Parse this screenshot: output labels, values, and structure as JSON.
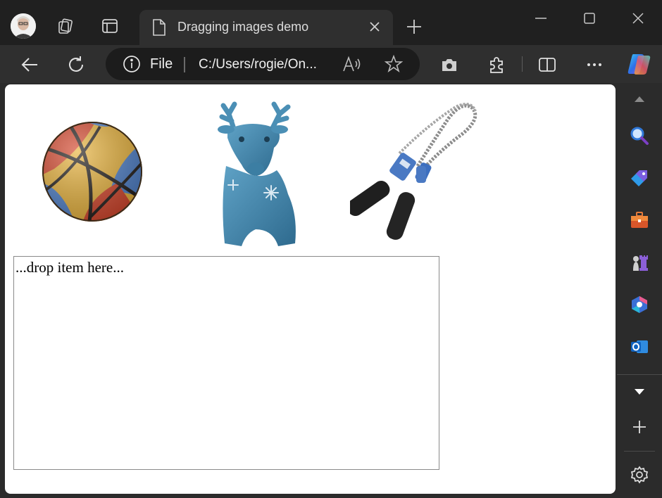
{
  "browser": {
    "tab": {
      "title": "Dragging images demo"
    },
    "address": {
      "scheme_label": "File",
      "url": "C:/Users/rogie/On..."
    },
    "colors": {
      "frame": "#202020",
      "toolbar": "#2f2f2f",
      "address_bg": "#1c1c1c",
      "content_bg": "#ffffff"
    }
  },
  "page": {
    "images": [
      {
        "name": "basketball",
        "icon": "basketball-image"
      },
      {
        "name": "inflatable deer toy",
        "icon": "deer-image"
      },
      {
        "name": "jump rope",
        "icon": "jump-rope-image"
      }
    ],
    "dropzone": {
      "text": "...drop item here..."
    }
  },
  "sidebar": {
    "items": [
      "search-icon",
      "tag-icon",
      "toolbox-icon",
      "chess-icon",
      "copilot-icon",
      "outlook-icon"
    ]
  }
}
